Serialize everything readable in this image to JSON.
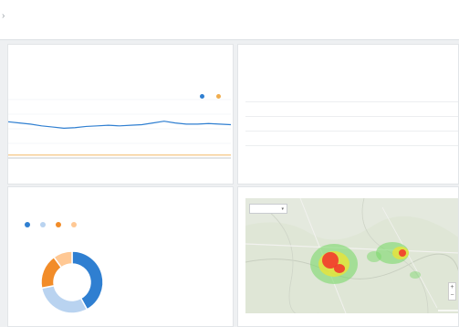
{
  "breadcrumb": {
    "separator": "›",
    "current": ""
  },
  "line_panel": {
    "title": "",
    "stat_1": "",
    "stat_2": "",
    "legend": [
      {
        "label": "",
        "color": "#2f7fd1"
      },
      {
        "label": "",
        "color": "#f0ad4e"
      }
    ],
    "x_ticks": [
      "",
      "",
      "",
      "",
      ""
    ],
    "x_axis_label": ""
  },
  "chart_data": {
    "type": "line",
    "x": [
      0,
      1,
      2,
      3,
      4,
      5,
      6,
      7,
      8,
      9,
      10,
      11,
      12,
      13,
      14,
      15,
      16,
      17,
      18,
      19,
      20
    ],
    "series": [
      {
        "color": "#2f7fd1",
        "values": [
          0.62,
          0.6,
          0.58,
          0.55,
          0.53,
          0.51,
          0.52,
          0.54,
          0.55,
          0.56,
          0.55,
          0.56,
          0.57,
          0.6,
          0.63,
          0.6,
          0.58,
          0.58,
          0.59,
          0.58,
          0.57
        ]
      },
      {
        "color": "#f0ad4e",
        "values": [
          0.05,
          0.05,
          0.05,
          0.05,
          0.05,
          0.05,
          0.05,
          0.05,
          0.05,
          0.05,
          0.05,
          0.05,
          0.05,
          0.05,
          0.05,
          0.05,
          0.05,
          0.05,
          0.05,
          0.05,
          0.05
        ]
      }
    ],
    "ylim": [
      0,
      1
    ],
    "grid": true,
    "legend": "top-right"
  },
  "donut_panel": {
    "title": "",
    "legend": [
      {
        "label": "",
        "color": "#2f7fd1",
        "value": 42
      },
      {
        "label": "",
        "color": "#b9d3f0",
        "value": 30
      },
      {
        "label": "",
        "color": "#f28c28",
        "value": 18
      },
      {
        "label": "",
        "color": "#ffc894",
        "value": 10
      }
    ],
    "side_heading": "",
    "side_lines": [
      "",
      "",
      ""
    ]
  },
  "efficiency_panel": {
    "title": "",
    "summary_text": "",
    "summary_value": "",
    "summary_suffix": "",
    "rows": [
      [
        "",
        "",
        ""
      ],
      [
        "",
        "",
        ""
      ],
      [
        "",
        "",
        ""
      ],
      [
        "",
        "",
        ""
      ]
    ]
  },
  "map_panel": {
    "title": "",
    "map_type": "",
    "google": "",
    "attribution": [
      "",
      "",
      ""
    ],
    "zoom_in": "+",
    "zoom_out": "−"
  }
}
